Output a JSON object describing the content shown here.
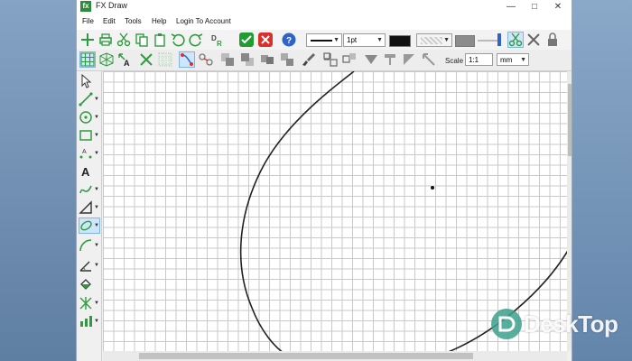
{
  "window": {
    "title": "FX Draw"
  },
  "menu": [
    "File",
    "Edit",
    "Tools",
    "Help",
    "Login To Account"
  ],
  "toolbar": {
    "line_width": "1pt"
  },
  "scale": {
    "label": "Scale",
    "value": "1:1",
    "unit": "mm"
  },
  "colors": {
    "accent_green": "#2e9c3e",
    "ok_green": "#1f9d32",
    "cancel_red": "#d9302c",
    "help_blue": "#2f63c8"
  },
  "left_tools": [
    "select-arrow-icon",
    "line-tool-icon",
    "circle-point-icon",
    "rectangle-tool-icon",
    "label-tool-icon",
    "text-tool-icon",
    "curve-tool-icon",
    "angle-tool-icon",
    "ellipse-tool-icon",
    "arc-tool-icon",
    "measure-angle-icon",
    "fill-tool-icon",
    "graph-tool-icon",
    "pattern-tool-icon"
  ],
  "watermark": {
    "text": "DeskTop"
  }
}
